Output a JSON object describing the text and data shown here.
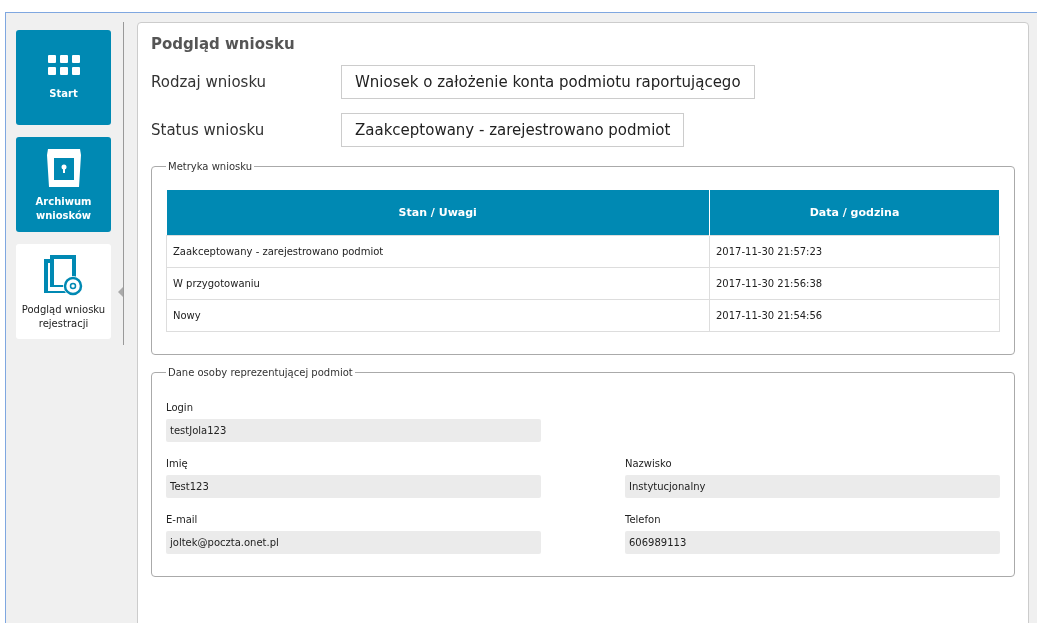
{
  "sidebar": {
    "items": [
      {
        "label": "Start",
        "selected": false
      },
      {
        "label": "Archiwum wniosków",
        "selected": false
      },
      {
        "label": "Podgląd wniosku rejestracji",
        "selected": true
      }
    ]
  },
  "panel": {
    "title": "Podgląd wniosku",
    "summary": [
      {
        "label": "Rodzaj wniosku",
        "value": "Wniosek o założenie konta podmiotu raportującego"
      },
      {
        "label": "Status wniosku",
        "value": "Zaakceptowany - zarejestrowano podmiot"
      }
    ],
    "metrics": {
      "legend": "Metryka wniosku",
      "columns": [
        "Stan / Uwagi",
        "Data / godzina"
      ],
      "rows": [
        [
          "Zaakceptowany - zarejestrowano podmiot",
          "2017-11-30 21:57:23"
        ],
        [
          "W przygotowaniu",
          "2017-11-30 21:56:38"
        ],
        [
          "Nowy",
          "2017-11-30 21:54:56"
        ]
      ]
    },
    "person": {
      "legend": "Dane osoby reprezentującej podmiot",
      "rows": [
        [
          {
            "label": "Login",
            "value": "testJola123"
          }
        ],
        [
          {
            "label": "Imię",
            "value": "Test123"
          },
          {
            "label": "Nazwisko",
            "value": "Instytucjonalny"
          }
        ],
        [
          {
            "label": "E-mail",
            "value": "joltek@poczta.onet.pl"
          },
          {
            "label": "Telefon",
            "value": "606989113"
          }
        ]
      ]
    }
  }
}
